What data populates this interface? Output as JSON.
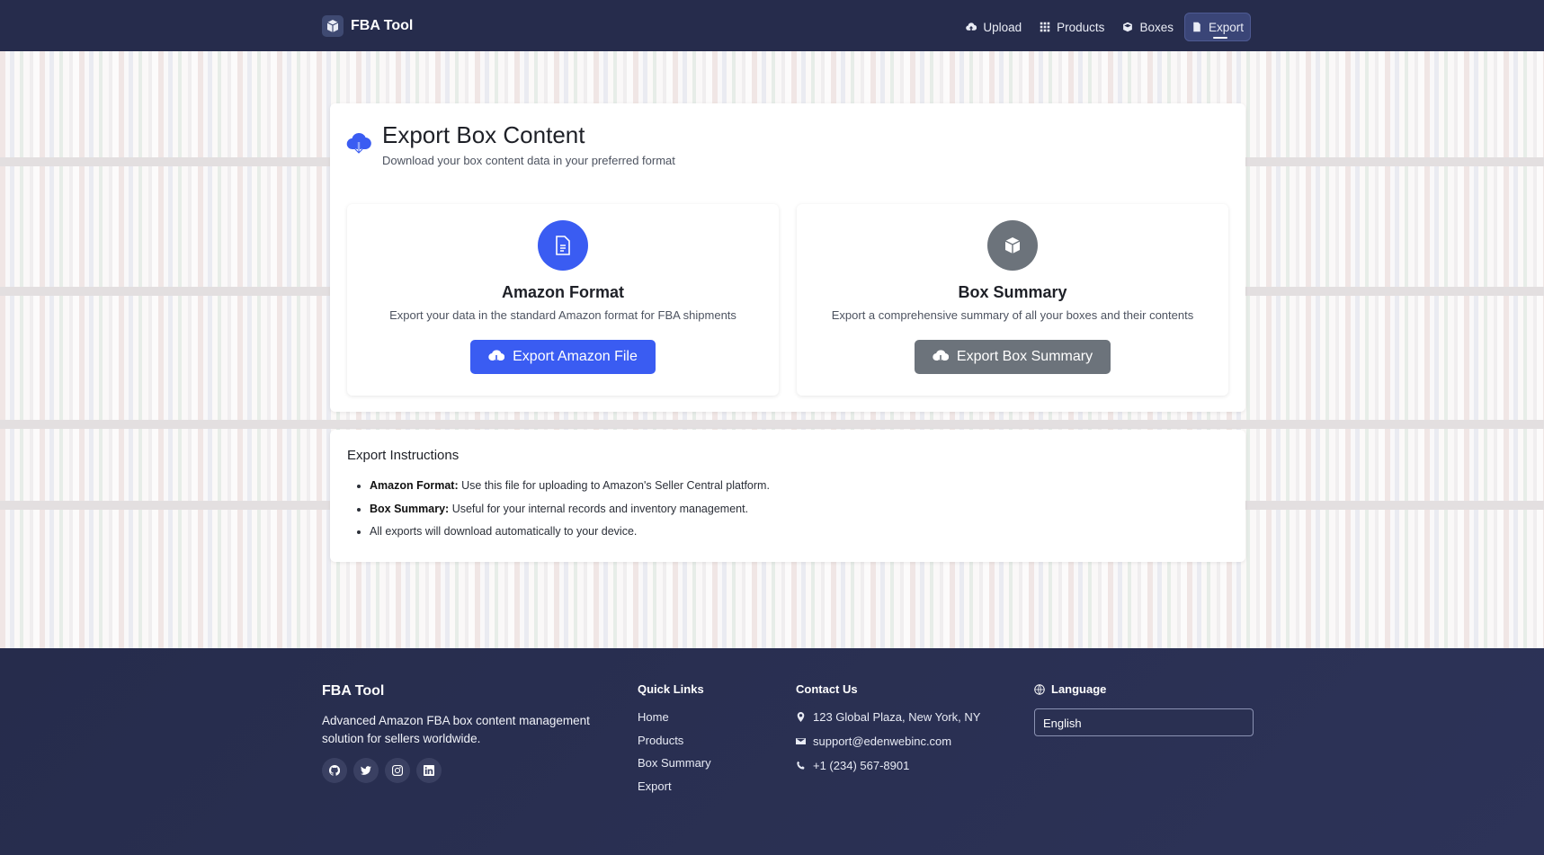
{
  "navbar": {
    "brand": "FBA Tool",
    "items": [
      {
        "label": "Upload",
        "icon": "cloud-upload-icon"
      },
      {
        "label": "Products",
        "icon": "grid-icon"
      },
      {
        "label": "Boxes",
        "icon": "box-icon"
      },
      {
        "label": "Export",
        "icon": "file-export-icon",
        "active": true
      }
    ]
  },
  "export": {
    "title": "Export Box Content",
    "subtitle": "Download your box content data in your preferred format",
    "options": [
      {
        "title": "Amazon Format",
        "description": "Export your data in the standard Amazon format for FBA shipments",
        "button": "Export Amazon File",
        "color": "#3a5cf2"
      },
      {
        "title": "Box Summary",
        "description": "Export a comprehensive summary of all your boxes and their contents",
        "button": "Export Box Summary",
        "color": "#6c737b"
      }
    ]
  },
  "instructions": {
    "title": "Export Instructions",
    "items": [
      {
        "bold": "Amazon Format:",
        "text": " Use this file for uploading to Amazon's Seller Central platform."
      },
      {
        "bold": "Box Summary:",
        "text": " Useful for your internal records and inventory management."
      },
      {
        "bold": "",
        "text": "All exports will download automatically to your device."
      }
    ]
  },
  "footer": {
    "brand": "FBA Tool",
    "description": "Advanced Amazon FBA box content management solution for sellers worldwide.",
    "socials": [
      "github-icon",
      "twitter-icon",
      "instagram-icon",
      "linkedin-icon"
    ],
    "quick_links_title": "Quick Links",
    "quick_links": [
      "Home",
      "Products",
      "Box Summary",
      "Export"
    ],
    "contact_title": "Contact Us",
    "contact": {
      "address": "123 Global Plaza, New York, NY",
      "email": "support@edenwebinc.com",
      "phone": "+1 (234) 567-8901"
    },
    "language_title": "Language",
    "language_value": "English"
  }
}
